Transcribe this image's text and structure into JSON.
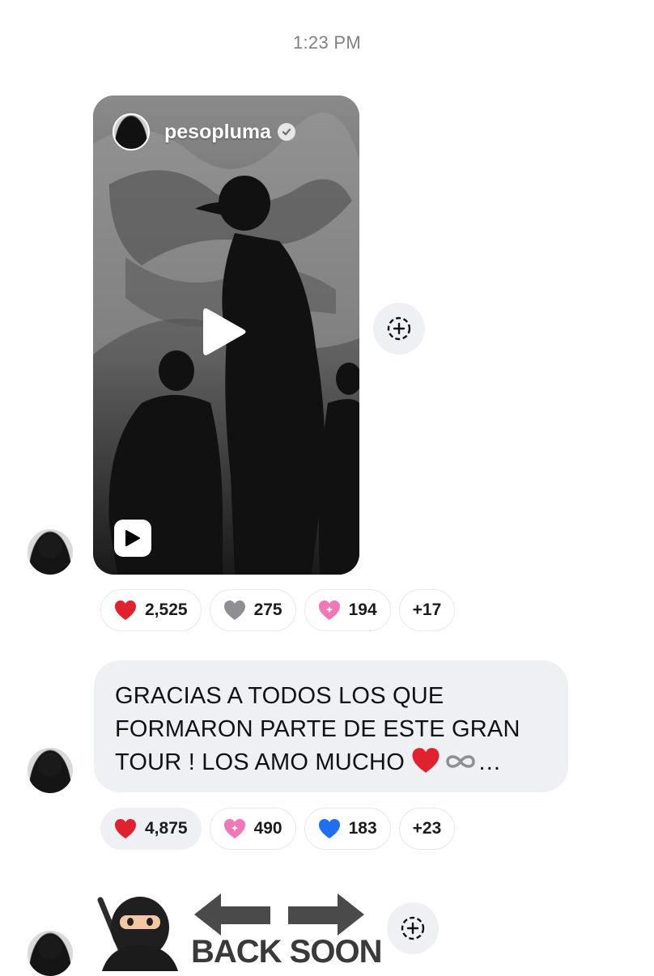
{
  "timestamp": "1:23 PM",
  "reel": {
    "username": "pesopluma",
    "verified": true,
    "icon": "reel-icon"
  },
  "reel_reactions": [
    {
      "emoji": "red-heart",
      "color": "#e0212f",
      "count": "2,525"
    },
    {
      "emoji": "grey-heart",
      "color": "#8e8e93",
      "count": "275"
    },
    {
      "emoji": "sparkling-heart",
      "color": "#f178b6",
      "count": "194"
    },
    {
      "emoji": "",
      "color": "",
      "count": "+17"
    }
  ],
  "message": {
    "lines": [
      "GRACIAS A TODOS LOS QUE",
      "FORMARON PARTE DE ESTE GRAN",
      "TOUR ! LOS AMO MUCHO"
    ],
    "trailing": "…"
  },
  "message_reactions": [
    {
      "emoji": "red-heart",
      "color": "#e0212f",
      "count": "4,875"
    },
    {
      "emoji": "sparkling-heart",
      "color": "#f178b6",
      "count": "490"
    },
    {
      "emoji": "blue-heart",
      "color": "#1f6ff0",
      "count": "183"
    },
    {
      "emoji": "",
      "color": "",
      "count": "+23"
    }
  ],
  "sticker": {
    "text": "BACK SOON",
    "icon": "ninja-sticker"
  },
  "share_icon": "share-plus-icon"
}
